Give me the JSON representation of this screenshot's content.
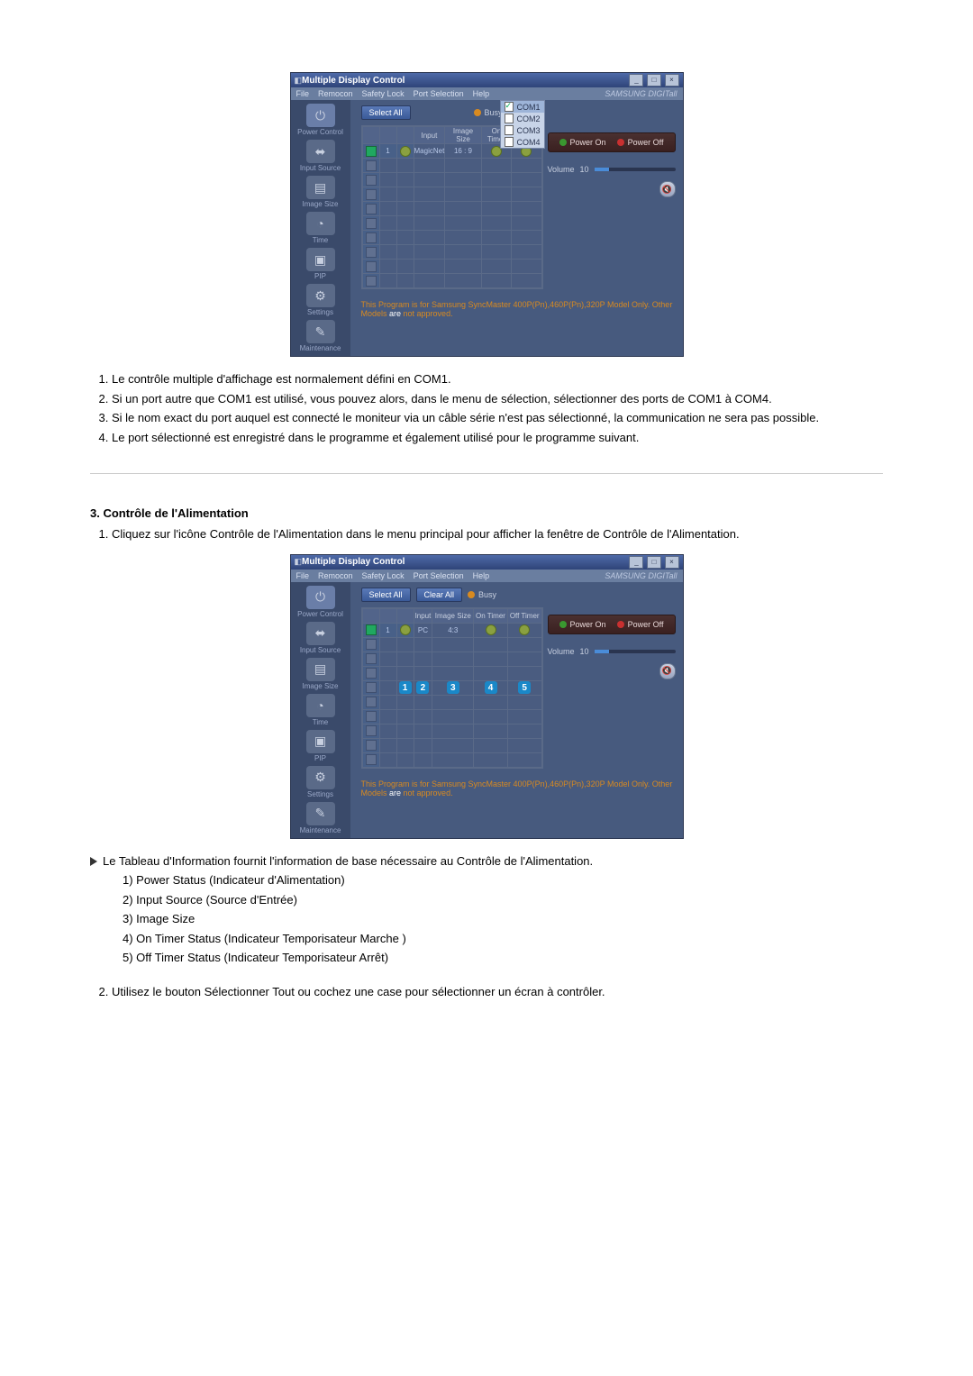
{
  "app": {
    "title": "Multiple Display Control",
    "menu": [
      "File",
      "Remocon",
      "Safety Lock",
      "Port Selection",
      "Help"
    ],
    "brand": "SAMSUNG DIGITall",
    "ports": [
      "COM1",
      "COM2",
      "COM3",
      "COM4"
    ],
    "select_all": "Select All",
    "clear_all": "Clear All",
    "busy": "Busy",
    "power_on": "Power On",
    "power_off": "Power Off",
    "volume_label": "Volume",
    "volume_value": "10",
    "cols": {
      "c1": "",
      "c2": "",
      "c3": "",
      "input": "Input",
      "size": "Image Size",
      "on": "On Timer",
      "off": "Off Timer"
    },
    "row1": {
      "input": "MagicNet",
      "size": "16 : 9"
    },
    "row1b": {
      "input": "PC",
      "size": "4:3"
    },
    "footer_a": "This Program is for Samsung SyncMaster 400P(Pn),460P(Pn),320P  Model Only. Other Models ",
    "footer_b": "are",
    "footer_c": " not approved.",
    "sidebar": [
      {
        "icon": "⏻",
        "label": "Power Control"
      },
      {
        "icon": "⬌",
        "label": "Input Source"
      },
      {
        "icon": "▤",
        "label": "Image Size"
      },
      {
        "icon": "◔",
        "label": "Time"
      },
      {
        "icon": "▣",
        "label": "PIP"
      },
      {
        "icon": "⚙",
        "label": "Settings"
      },
      {
        "icon": "✎",
        "label": "Maintenance"
      }
    ]
  },
  "text": {
    "list1": {
      "i1": "Le contrôle multiple d'affichage est normalement défini en COM1.",
      "i2": "Si un port autre que COM1 est utilisé, vous pouvez alors, dans le menu de sélection, sélectionner des ports de COM1 à COM4.",
      "i3": "Si le nom exact du port auquel est connecté le moniteur via un câble série n'est pas sélectionné, la communication ne sera pas possible.",
      "i4": "Le port sélectionné est enregistré dans le programme et également utilisé pour le programme suivant."
    },
    "section3": "3. Contrôle de l'Alimentation",
    "p1": "Cliquez sur l'icône Contrôle de l'Alimentation dans le menu principal pour afficher la fenêtre de Contrôle de l'Alimentation.",
    "tableau": "Le Tableau d'Information fournit l'information de base nécessaire au Contrôle de l'Alimentation.",
    "sub": {
      "s1": "1) Power Status (Indicateur d'Alimentation)",
      "s2": "2) Input Source (Source d'Entrée)",
      "s3": "3) Image Size",
      "s4": "4) On Timer Status (Indicateur Temporisateur Marche )",
      "s5": "5) Off Timer Status (Indicateur Temporisateur Arrêt)"
    },
    "p2": "Utilisez le bouton Sélectionner Tout ou cochez une case pour sélectionner un écran à contrôler."
  }
}
